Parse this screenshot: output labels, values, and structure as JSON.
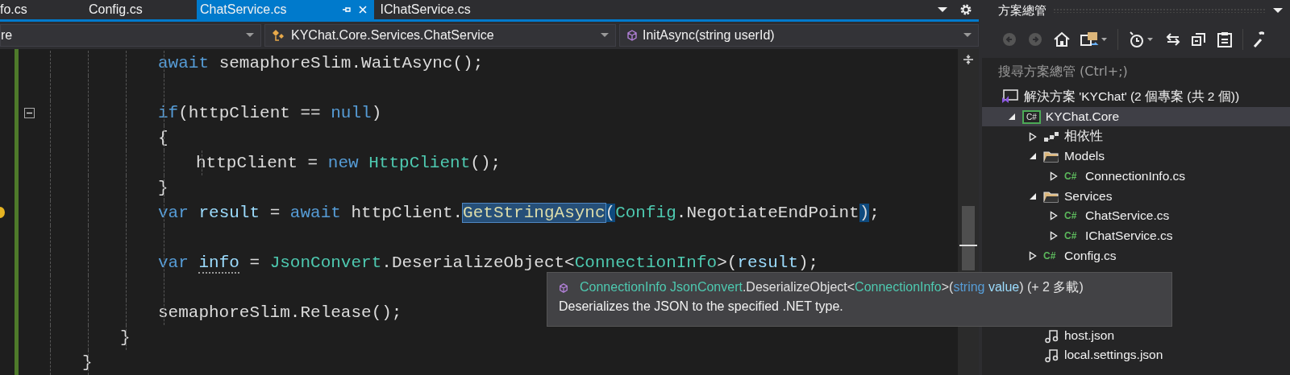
{
  "tabs": [
    {
      "label": "fo.cs",
      "selected": false
    },
    {
      "label": "Config.cs",
      "selected": false
    },
    {
      "label": "ChatService.cs",
      "selected": true
    },
    {
      "label": "IChatService.cs",
      "selected": false
    }
  ],
  "navigation_bar": {
    "project": "re",
    "type": "KYChat.Core.Services.ChatService",
    "member": "InitAsync(string userId)"
  },
  "code": [
    {
      "kind": "block",
      "children": [
        {
          "kind": "block",
          "children": [
            {
              "kind": "line",
              "tokens": [
                {
                  "t": "await ",
                  "kind": "kw"
                },
                {
                  "t": "semaphoreSlim.WaitAsync();",
                  "kind": "plain"
                }
              ]
            },
            {
              "kind": "blank"
            },
            {
              "kind": "line",
              "collapsible": true,
              "tokens": [
                {
                  "t": "if",
                  "kind": "kw"
                },
                {
                  "t": "(httpClient == ",
                  "kind": "plain"
                },
                {
                  "t": "null",
                  "kind": "kw"
                },
                {
                  "t": ")",
                  "kind": "plain"
                }
              ]
            },
            {
              "kind": "line",
              "tokens": [
                {
                  "t": "{",
                  "kind": "plain"
                }
              ]
            },
            {
              "kind": "block",
              "children": [
                {
                  "kind": "line",
                  "tokens": [
                    {
                      "t": "httpClient = ",
                      "kind": "plain"
                    },
                    {
                      "t": "new ",
                      "kind": "kw"
                    },
                    {
                      "t": "HttpClient",
                      "kind": "type"
                    },
                    {
                      "t": "();",
                      "kind": "plain"
                    }
                  ]
                }
              ]
            },
            {
              "kind": "line",
              "tokens": [
                {
                  "t": "}",
                  "kind": "plain"
                }
              ]
            },
            {
              "kind": "line",
              "lightbulb": true,
              "tokens": [
                {
                  "t": "var ",
                  "kind": "kw"
                },
                {
                  "t": "result",
                  "kind": "local"
                },
                {
                  "t": " = ",
                  "kind": "plain"
                },
                {
                  "t": "await ",
                  "kind": "kw"
                },
                {
                  "t": "httpClient.",
                  "kind": "plain"
                },
                {
                  "t": "GetStringAsync",
                  "kind": "selected"
                },
                {
                  "t": "(",
                  "kind": "match"
                },
                {
                  "t": "Config",
                  "kind": "type"
                },
                {
                  "t": ".NegotiateEndPoint",
                  "kind": "plain"
                },
                {
                  "t": ")",
                  "kind": "match"
                },
                {
                  "t": ";",
                  "kind": "plain"
                }
              ]
            },
            {
              "kind": "blank"
            },
            {
              "kind": "line",
              "tokens": [
                {
                  "t": "var ",
                  "kind": "kw"
                },
                {
                  "t": "info",
                  "kind": "hint"
                },
                {
                  "t": " = ",
                  "kind": "plain"
                },
                {
                  "t": "JsonConvert",
                  "kind": "type"
                },
                {
                  "t": ".DeserializeObject<",
                  "kind": "plain"
                },
                {
                  "t": "ConnectionInfo",
                  "kind": "type"
                },
                {
                  "t": ">(",
                  "kind": "plain"
                },
                {
                  "t": "result",
                  "kind": "local"
                },
                {
                  "t": ");",
                  "kind": "plain"
                }
              ]
            },
            {
              "kind": "blank"
            },
            {
              "kind": "line",
              "tokens": [
                {
                  "t": "semaphoreSlim.Release();",
                  "kind": "plain"
                }
              ]
            }
          ]
        },
        {
          "kind": "line",
          "tokens": [
            {
              "t": "}",
              "kind": "plain"
            }
          ]
        }
      ]
    },
    {
      "kind": "line",
      "tokens": [
        {
          "t": "}",
          "kind": "plain"
        }
      ]
    }
  ],
  "tooltip": {
    "signature": [
      {
        "t": "ConnectionInfo",
        "kind": "type"
      },
      {
        "t": " JsonConvert",
        "kind": "type"
      },
      {
        "t": ".DeserializeObject<",
        "kind": "plain"
      },
      {
        "t": "ConnectionInfo",
        "kind": "type"
      },
      {
        "t": ">(",
        "kind": "plain"
      },
      {
        "t": "string",
        "kind": "kw"
      },
      {
        "t": " value",
        "kind": "local"
      },
      {
        "t": ") (+ 2 多載)",
        "kind": "plain"
      }
    ],
    "description": "Deserializes the JSON to the specified .NET type."
  },
  "solution_explorer": {
    "title": "方案總管",
    "search": {
      "placeholder": "搜尋方案總管 (Ctrl+;)"
    },
    "tree": [
      {
        "label": "解決方案 'KYChat' (2 個專案 (共 2 個))",
        "kind": "solution",
        "selected": false,
        "children": [
          {
            "label": "KYChat.Core",
            "kind": "project",
            "badge": "C#",
            "expanded": true,
            "selected": true,
            "children": [
              {
                "label": "相依性",
                "kind": "deps",
                "expanded": false,
                "selected": false
              },
              {
                "label": "Models",
                "kind": "folder",
                "expanded": true,
                "selected": false,
                "children": [
                  {
                    "label": "ConnectionInfo.cs",
                    "kind": "cs",
                    "badge": "C#",
                    "expanded": false,
                    "selected": false
                  }
                ]
              },
              {
                "label": "Services",
                "kind": "folder",
                "expanded": true,
                "selected": false,
                "children": [
                  {
                    "label": "ChatService.cs",
                    "kind": "cs",
                    "badge": "C#",
                    "expanded": false,
                    "selected": false
                  },
                  {
                    "label": "IChatService.cs",
                    "kind": "cs",
                    "badge": "C#",
                    "expanded": false,
                    "selected": false
                  }
                ]
              },
              {
                "label": "Config.cs",
                "kind": "cs",
                "badge": "C#",
                "expanded": false,
                "selected": false
              }
            ]
          }
        ]
      }
    ],
    "tree_below_tooltip": [
      {
        "label": "host.json",
        "kind": "json",
        "selected": false
      },
      {
        "label": "local.settings.json",
        "kind": "json",
        "selected": false
      }
    ]
  }
}
